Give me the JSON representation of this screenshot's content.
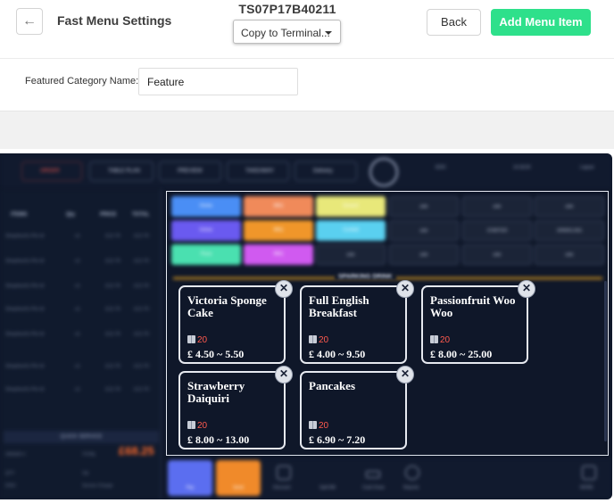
{
  "header": {
    "back_arrow": "←",
    "title": "Fast Menu Settings",
    "terminal_id": "TS07P17B40211",
    "copy_select_value": "Copy to Terminal...",
    "back_label": "Back",
    "add_label": "Add Menu Item",
    "accent_color": "#2ee08b"
  },
  "featured": {
    "label": "Featured Category Name:",
    "value": "Feature"
  },
  "pos": {
    "tabs": [
      "ORDER",
      "TABLE PLAN",
      "PREVIEW",
      "TAKEAWAY",
      "Delivery"
    ],
    "topbar_right": [
      "EDIC",
      "14:18:20",
      "Logout"
    ],
    "order_headers": [
      "ITEMS",
      "Qty",
      "PRICE",
      "TOTAL"
    ],
    "order_rows": [
      [
        "Shepherd's Pie Id",
        "x1",
        "£12.70",
        "£12.70"
      ],
      [
        "Shepherd's Pie Id",
        "x1",
        "£12.70",
        "£12.70"
      ],
      [
        "Shepherd's Pie Id",
        "x1",
        "£12.70",
        "£12.70"
      ],
      [
        "Shepherd's Pie Id",
        "x1",
        "£12.70",
        "£12.70"
      ],
      [
        "Shepherd's Pie Id",
        "x1",
        "£12.70",
        "£12.70"
      ],
      [
        "Shepherd's Pie Id",
        "x1",
        "£12.70",
        "£12.70"
      ],
      [
        "Shepherd's Pie Id",
        "x1",
        "£12.70",
        "£12.70"
      ]
    ],
    "quick_service": "QUICK SERVICE",
    "order_label": "ORDER #",
    "total_label": "TOTAL",
    "total_value": "£68.25",
    "qty_label": "QTY",
    "disc_label": "DISC",
    "vat_label": "Vat",
    "service_label": "Service Charge",
    "categories": [
      "Drinks",
      "BBQ",
      "Dessert",
      "side",
      "side",
      "side",
      "Extras",
      "BBQ",
      "Cocktail",
      "side",
      "STARTER",
      "SPARKLING",
      "Pizza",
      "BBQ",
      "side",
      "side",
      "side",
      "side"
    ],
    "section_title": "SPARKING DRINK",
    "bottom_buttons": [
      "Pay",
      "Send",
      "Discount",
      "Split Bill",
      "Cash Draw",
      "Reports",
      "MORE"
    ]
  },
  "items": [
    {
      "name": "Victoria Sponge Cake",
      "stock": "20",
      "price": "£ 4.50 ~ 5.50"
    },
    {
      "name": "Full English Breakfast",
      "stock": "20",
      "price": "£ 4.00 ~ 9.50"
    },
    {
      "name": "Passionfruit Woo Woo",
      "stock": "20",
      "price": "£ 8.00 ~ 25.00"
    },
    {
      "name": "Strawberry Daiquiri",
      "stock": "20",
      "price": "£ 8.00 ~ 13.00"
    },
    {
      "name": "Pancakes",
      "stock": "20",
      "price": "£ 6.90 ~ 7.20"
    }
  ],
  "close_glyph": "✕"
}
